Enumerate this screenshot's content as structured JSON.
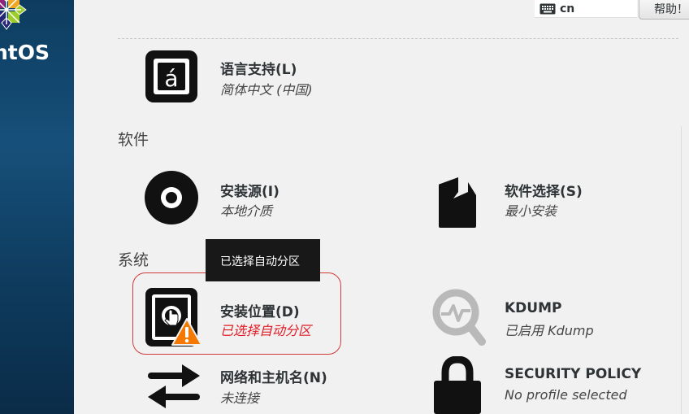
{
  "sidebar": {
    "brand": "ntOS",
    "logo": "centos-logo"
  },
  "topbar": {
    "keyboard_layout": "cn",
    "keyboard_icon": "keyboard-icon",
    "help_label": "帮助！"
  },
  "localization": {
    "language": {
      "title": "语言支持(L)",
      "status": "简体中文 (中国)",
      "icon": "language-icon"
    }
  },
  "software": {
    "label": "软件",
    "source": {
      "title": "安装源(I)",
      "status": "本地介质",
      "icon": "disc-icon"
    },
    "selection": {
      "title": "软件选择(S)",
      "status": "最小安装",
      "icon": "package-icon"
    }
  },
  "system": {
    "label": "系统",
    "destination": {
      "title": "安装位置(D)",
      "status": "已选择自动分区",
      "icon": "disk-icon",
      "warning_icon": "warning-icon"
    },
    "kdump": {
      "title": "KDUMP",
      "status": "已启用 Kdump",
      "icon": "magnifier-icon"
    },
    "network": {
      "title": "网络和主机名(N)",
      "status": "未连接",
      "icon": "network-arrows-icon"
    },
    "security": {
      "title": "SECURITY POLICY",
      "status": "No profile selected",
      "icon": "lock-icon"
    }
  },
  "tooltip": {
    "text": "已选择自动分区"
  },
  "colors": {
    "sidebar": "#0d3c5f",
    "warning": "#e01b24",
    "warning_badge": "#f57900",
    "tooltip_bg": "#181818",
    "background": "#f1f1f1"
  }
}
